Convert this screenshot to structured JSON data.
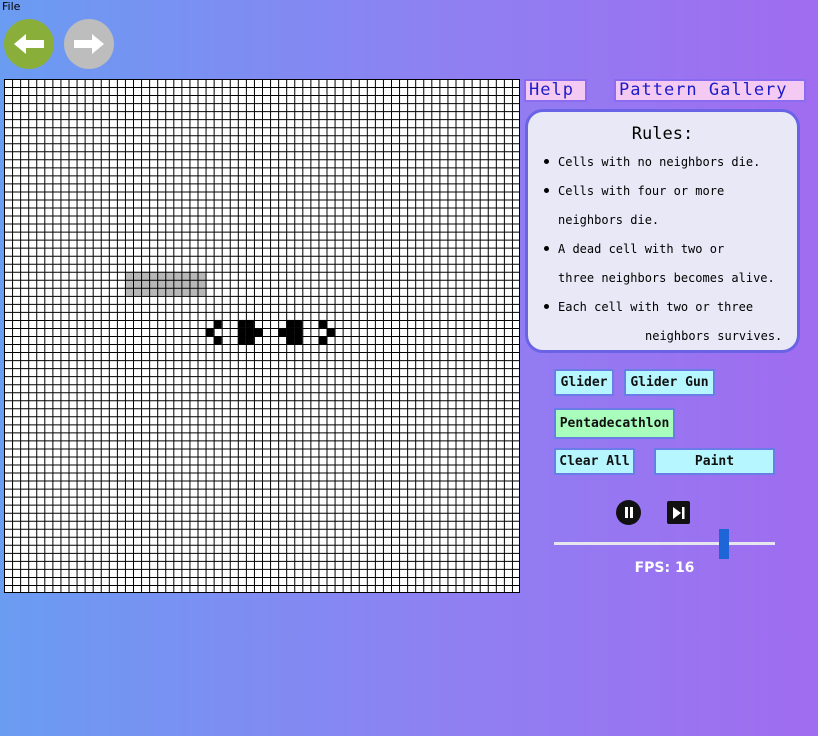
{
  "menu": {
    "file_label": "File"
  },
  "nav": {
    "back_icon": "arrow-left-icon",
    "forward_icon": "arrow-right-icon",
    "back_color": "#8aae3a",
    "forward_color": "#bdbdbd"
  },
  "header_buttons": {
    "help_label": "Help",
    "gallery_label": "Pattern Gallery"
  },
  "rules": {
    "title": "Rules:",
    "items": [
      {
        "line1": "Cells with no neighbors die.",
        "line2": ""
      },
      {
        "line1": "Cells with four or more",
        "line2": "neighbors die."
      },
      {
        "line1": "A dead cell with two or",
        "line2": "three neighbors becomes alive."
      },
      {
        "line1": "Each cell with two or three",
        "line2": "neighbors survives."
      }
    ]
  },
  "patterns": {
    "glider_label": "Glider",
    "glider_gun_label": "Glider Gun",
    "pentadecathlon_label": "Pentadecathlon",
    "clear_label": "Clear All",
    "paint_label": "Paint"
  },
  "playback": {
    "pause_icon": "pause-icon",
    "step_icon": "step-forward-icon",
    "fps_label": "FPS: 16",
    "fps_value": 16,
    "slider_fraction": 0.78
  },
  "grid": {
    "cols": 64,
    "rows": 64,
    "line_color": "#000000",
    "alive_color": "#000000",
    "highlight_color": "#b7b7b7",
    "highlight_cells": [
      [
        15,
        24
      ],
      [
        16,
        24
      ],
      [
        17,
        24
      ],
      [
        18,
        24
      ],
      [
        19,
        24
      ],
      [
        20,
        24
      ],
      [
        21,
        24
      ],
      [
        22,
        24
      ],
      [
        23,
        24
      ],
      [
        24,
        24
      ],
      [
        15,
        25
      ],
      [
        16,
        25
      ],
      [
        17,
        25
      ],
      [
        18,
        25
      ],
      [
        19,
        25
      ],
      [
        20,
        25
      ],
      [
        21,
        25
      ],
      [
        22,
        25
      ],
      [
        23,
        25
      ],
      [
        24,
        25
      ],
      [
        15,
        26
      ],
      [
        16,
        26
      ],
      [
        17,
        26
      ],
      [
        18,
        26
      ],
      [
        19,
        26
      ],
      [
        20,
        26
      ],
      [
        21,
        26
      ],
      [
        22,
        26
      ],
      [
        23,
        26
      ],
      [
        24,
        26
      ]
    ],
    "alive_cells": [
      [
        26,
        30
      ],
      [
        25,
        31
      ],
      [
        26,
        32
      ],
      [
        29,
        30
      ],
      [
        30,
        30
      ],
      [
        29,
        31
      ],
      [
        30,
        31
      ],
      [
        31,
        31
      ],
      [
        29,
        32
      ],
      [
        30,
        32
      ],
      [
        35,
        30
      ],
      [
        36,
        30
      ],
      [
        34,
        31
      ],
      [
        35,
        31
      ],
      [
        36,
        31
      ],
      [
        35,
        32
      ],
      [
        36,
        32
      ],
      [
        39,
        30
      ],
      [
        40,
        31
      ],
      [
        39,
        32
      ]
    ]
  }
}
